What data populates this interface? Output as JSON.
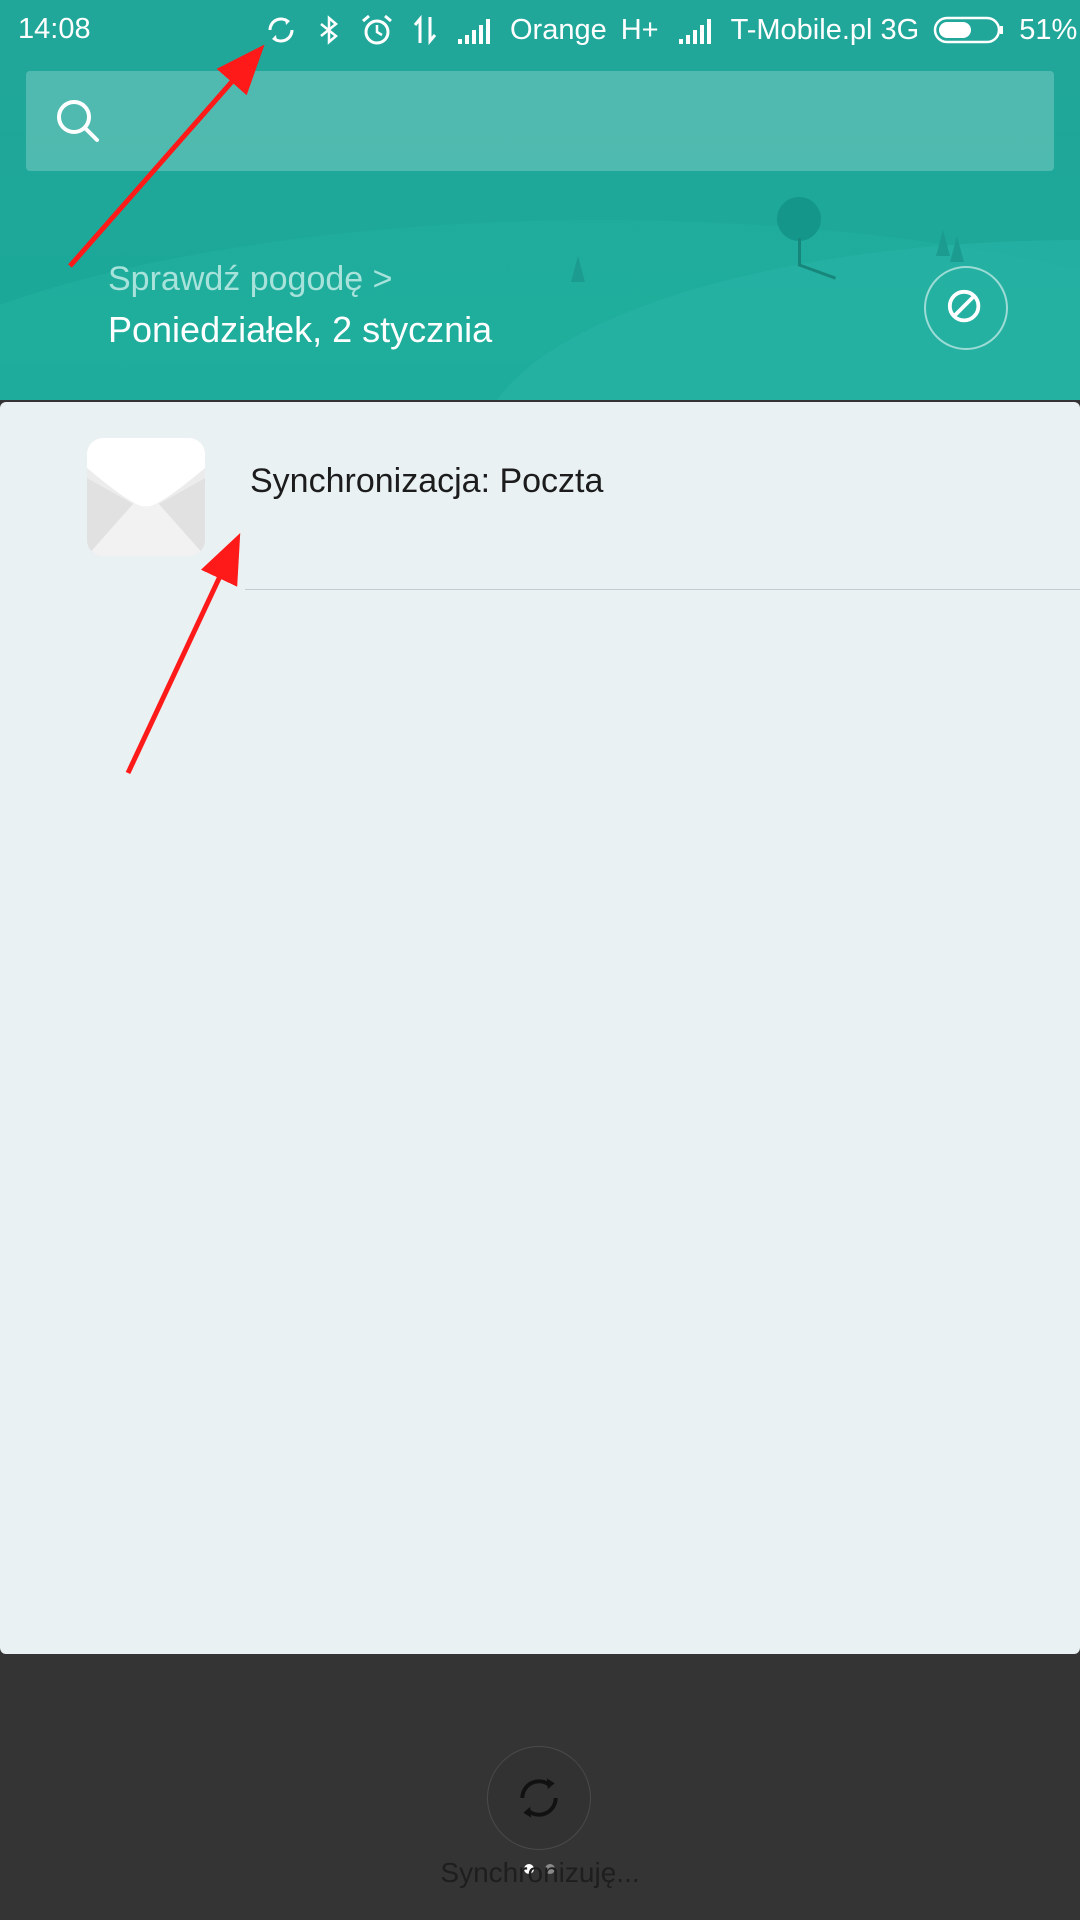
{
  "status_bar": {
    "time": "14:08",
    "carrier1": "Orange",
    "network1": "H+",
    "carrier2": "T-Mobile.pl",
    "network2": "3G",
    "battery_percent": "51%",
    "icons": [
      "sync-icon",
      "bluetooth-icon",
      "alarm-icon",
      "data-transfer-icon",
      "signal-icon",
      "signal-icon",
      "battery-icon"
    ]
  },
  "search": {
    "placeholder": ""
  },
  "weather": {
    "link": "Sprawdź pogodę >",
    "date": "Poniedziałek, 2 stycznia"
  },
  "notification": {
    "app_icon": "mail-icon",
    "title": "Synchronizacja: Poczta"
  },
  "footer": {
    "sync_label": "Synchronizuję...",
    "page_count": 2,
    "active_page": 1
  },
  "colors": {
    "header": "#1ea99a",
    "panel": "#e9f1f3",
    "background": "#343434",
    "annotation": "#ff0000"
  }
}
